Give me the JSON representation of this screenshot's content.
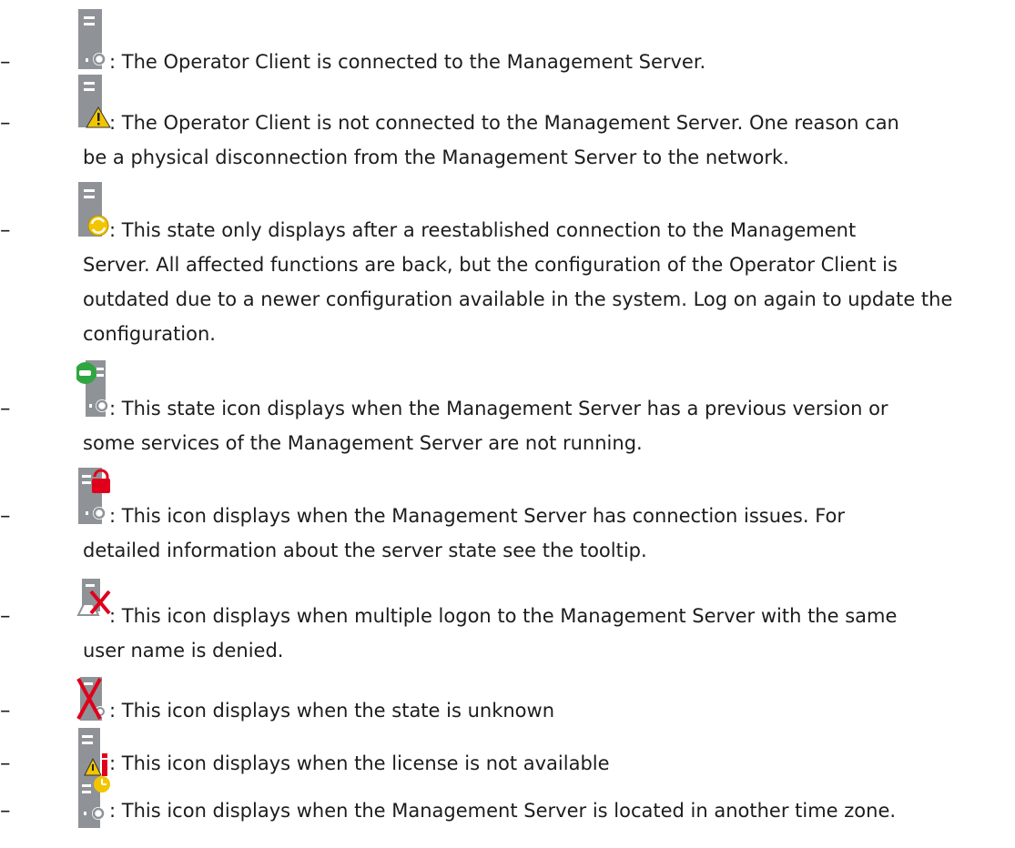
{
  "list_bullet": "–",
  "items": [
    {
      "icon": "server-connected-icon",
      "text_first": ": The Operator Client is connected to the Management Server.",
      "text_rest": []
    },
    {
      "icon": "server-disconnected-warning-icon",
      "text_first": ": The Operator Client is not connected to the Management Server. One reason can",
      "text_rest": [
        "be a physical disconnection from the Management Server to the network."
      ]
    },
    {
      "icon": "server-config-outdated-icon",
      "text_first": ": This state only displays after a reestablished connection to the Management",
      "text_rest": [
        "Server. All affected functions are back, but the configuration of the Operator Client is",
        "outdated due to a newer configuration available in the system. Log on again to update the",
        "configuration."
      ]
    },
    {
      "icon": "server-previous-version-icon",
      "text_first": ": This state icon displays when the Management Server has a previous version or",
      "text_rest": [
        "some services of the Management Server are not running."
      ]
    },
    {
      "icon": "server-connection-issues-lock-icon",
      "text_first": ": This icon displays when the Management Server has connection issues. For",
      "text_rest": [
        "detailed information about the server state see the tooltip."
      ]
    },
    {
      "icon": "server-multiple-logon-denied-icon",
      "text_first": ": This icon displays when multiple logon to the Management Server with the same",
      "text_rest": [
        "user name is denied."
      ]
    },
    {
      "icon": "server-unknown-state-icon",
      "text_first": ": This icon displays when the state is unknown",
      "text_rest": []
    },
    {
      "icon": "server-license-unavailable-icon",
      "text_first": ": This icon displays when the license is not available",
      "text_rest": []
    },
    {
      "icon": "server-other-timezone-icon",
      "text_first": ": This icon displays when the Management Server is located in another time zone.",
      "text_rest": []
    }
  ],
  "colors": {
    "server": "#8f9397",
    "warning": "#f2c500",
    "alert_red": "#e0001b",
    "green": "#2fa640",
    "text": "#1c1c1c"
  }
}
